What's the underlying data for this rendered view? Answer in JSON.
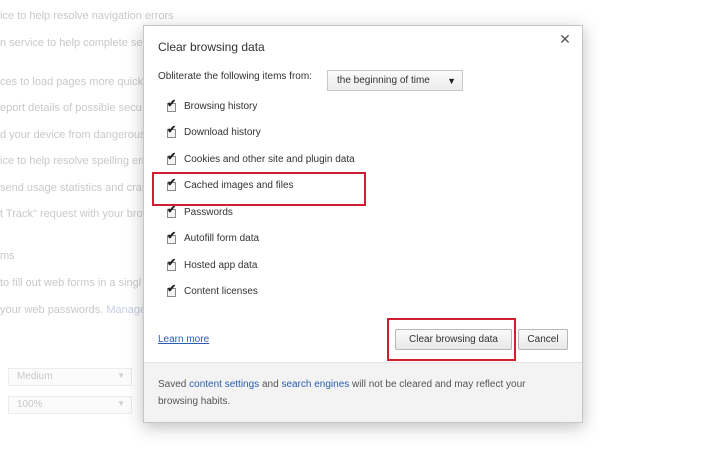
{
  "background": {
    "lines": [
      "ice to help resolve navigation errors",
      "n service to help complete sea",
      "ces to load pages more quick",
      "eport details of possible secu",
      "d your device from dangerous",
      "ice to help resolve spelling err",
      "send usage statistics and crash",
      "t Track\" request with your brow",
      "ms",
      "to fill out web forms in a singl",
      "your web passwords."
    ],
    "manage_link": "Manage p",
    "select_1": "Medium",
    "select_2": "100%"
  },
  "dialog": {
    "title": "Clear browsing data",
    "close_icon": "close-icon",
    "obliterate_label": "Obliterate the following items from:",
    "period_selected": "the beginning of time",
    "items": [
      {
        "label": "Browsing history",
        "checked": true
      },
      {
        "label": "Download history",
        "checked": true
      },
      {
        "label": "Cookies and other site and plugin data",
        "checked": true
      },
      {
        "label": "Cached images and files",
        "checked": true
      },
      {
        "label": "Passwords",
        "checked": true
      },
      {
        "label": "Autofill form data",
        "checked": true
      },
      {
        "label": "Hosted app data",
        "checked": true
      },
      {
        "label": "Content licenses",
        "checked": true
      }
    ],
    "learn_more": "Learn more",
    "clear_button": "Clear browsing data",
    "cancel_button": "Cancel",
    "footer": {
      "prefix": "Saved ",
      "content_settings_link": "content settings",
      "and_text": " and ",
      "search_engines_link": "search engines",
      "suffix": " will not be cleared and may reflect your browsing habits."
    }
  },
  "colors": {
    "highlight": "#d02030",
    "link": "#2a5db0"
  }
}
